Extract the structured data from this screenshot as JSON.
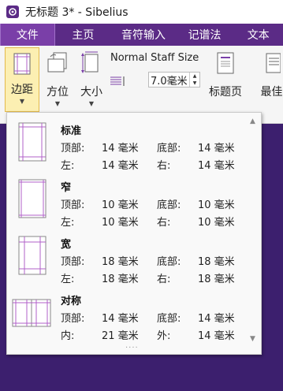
{
  "window": {
    "title": "无标题 3* - Sibelius",
    "app_icon": "sibelius-logo-icon"
  },
  "menu": {
    "tabs": [
      {
        "label": "文件",
        "active": true
      },
      {
        "label": "主页",
        "active": false
      },
      {
        "label": "音符输入",
        "active": false
      },
      {
        "label": "记谱法",
        "active": false
      },
      {
        "label": "文本",
        "active": false
      }
    ]
  },
  "ribbon": {
    "margins_label": "边距",
    "orientation_label": "方位",
    "size_label": "大小",
    "staff_size_label": "Normal Staff Size",
    "staff_size_value": "7.0毫米",
    "title_page_label": "标题页",
    "cut_label": "最佳"
  },
  "margins_panel": {
    "options": [
      {
        "name": "标准",
        "top_label": "顶部:",
        "top_value": "14 毫米",
        "bottom_label": "底部:",
        "bottom_value": "14 毫米",
        "left_label": "左:",
        "left_value": "14 毫米",
        "right_label": "右:",
        "right_value": "14 毫米"
      },
      {
        "name": "窄",
        "top_label": "顶部:",
        "top_value": "10 毫米",
        "bottom_label": "底部:",
        "bottom_value": "10 毫米",
        "left_label": "左:",
        "left_value": "10 毫米",
        "right_label": "右:",
        "right_value": "10 毫米"
      },
      {
        "name": "宽",
        "top_label": "顶部:",
        "top_value": "18 毫米",
        "bottom_label": "底部:",
        "bottom_value": "18 毫米",
        "left_label": "左:",
        "left_value": "18 毫米",
        "right_label": "右:",
        "right_value": "18 毫米"
      },
      {
        "name": "对称",
        "top_label": "顶部:",
        "top_value": "14 毫米",
        "bottom_label": "底部:",
        "bottom_value": "14 毫米",
        "left_label": "内:",
        "left_value": "21 毫米",
        "right_label": "外:",
        "right_value": "14 毫米"
      }
    ]
  },
  "colors": {
    "menubar": "#5b2b86",
    "active_tab": "#7a3fa8",
    "margin_guide": "#b060c8",
    "selected_button": "#fcefb2"
  }
}
